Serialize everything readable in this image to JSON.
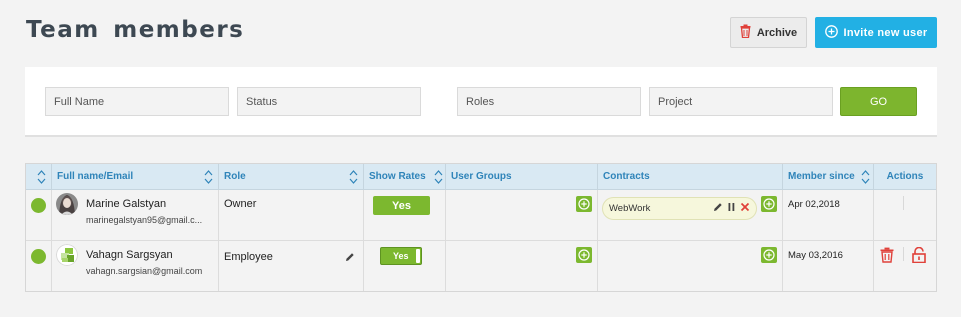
{
  "page": {
    "title": "Team members"
  },
  "header": {
    "archive_label": "Archive",
    "invite_label": "Invite new user"
  },
  "filters": {
    "full_name_placeholder": "Full Name",
    "status_placeholder": "Status",
    "roles_placeholder": "Roles",
    "project_placeholder": "Project",
    "go_label": "GO"
  },
  "table": {
    "columns": [
      "Full name/Email",
      "Role",
      "Show Rates",
      "User Groups",
      "Contracts",
      "Member since",
      "Actions"
    ],
    "rows": [
      {
        "name": "Marine Galstyan",
        "email": "marinegalstyan95@gmail.c...",
        "role": "Owner",
        "show_rates": "Yes",
        "contract": "WebWork",
        "member_since": "Apr 02,2018"
      },
      {
        "name": "Vahagn Sargsyan",
        "email": "vahagn.sargsian@gmail.com",
        "role": "Employee",
        "show_rates": "Yes",
        "contract": "",
        "member_since": "May 03,2016"
      }
    ]
  },
  "colors": {
    "accent_blue": "#22b0e4",
    "green": "#7cb82f",
    "danger": "#e0413a",
    "header_text": "#2f84b9"
  }
}
